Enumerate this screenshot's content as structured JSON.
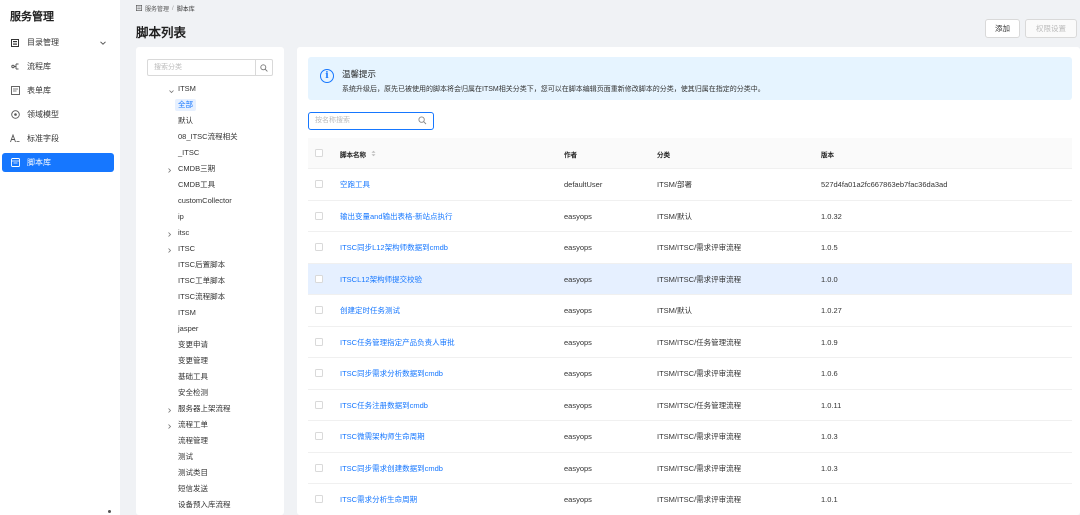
{
  "nav": {
    "title": "服务管理",
    "items": [
      {
        "label": "目录管理",
        "icon": "catalog-icon"
      },
      {
        "label": "流程库",
        "icon": "flow-icon"
      },
      {
        "label": "表单库",
        "icon": "form-icon"
      },
      {
        "label": "领域模型",
        "icon": "domain-model-icon"
      },
      {
        "label": "标准字段",
        "icon": "standard-field-icon"
      },
      {
        "label": "脚本库",
        "icon": "script-icon"
      }
    ],
    "active": "脚本库"
  },
  "header": {
    "breadcrumb": [
      "服务管理",
      "脚本库"
    ],
    "breadcrumb_sep": "/",
    "title": "脚本列表",
    "add_label": "添加",
    "perm_label": "权限设置"
  },
  "category": {
    "search_placeholder": "搜索分类",
    "root": "ITSM",
    "nodes": [
      {
        "label": "全部",
        "selected": true
      },
      {
        "label": "默认"
      },
      {
        "label": "08_ITSC流程相关"
      },
      {
        "label": "_ITSC"
      },
      {
        "label": "CMDB三期",
        "expandable": true
      },
      {
        "label": "CMDB工具"
      },
      {
        "label": "customCollector"
      },
      {
        "label": "ip"
      },
      {
        "label": "itsc",
        "expandable": true
      },
      {
        "label": "ITSC",
        "expandable": true
      },
      {
        "label": "ITSC后置脚本"
      },
      {
        "label": "ITSC工单脚本"
      },
      {
        "label": "ITSC流程脚本"
      },
      {
        "label": "ITSM"
      },
      {
        "label": "jasper"
      },
      {
        "label": "变更申请"
      },
      {
        "label": "变更管理"
      },
      {
        "label": "基础工具"
      },
      {
        "label": "安全检测"
      },
      {
        "label": "服务器上架流程",
        "expandable": true
      },
      {
        "label": "流程工单",
        "expandable": true
      },
      {
        "label": "流程管理"
      },
      {
        "label": "测试"
      },
      {
        "label": "测试类目"
      },
      {
        "label": "短信发送"
      },
      {
        "label": "设备预入库流程"
      }
    ]
  },
  "tip": {
    "title": "温馨提示",
    "text": "系统升级后，原先已被使用的脚本将会归属在ITSM相关分类下，您可以在脚本编辑页面重新修改脚本的分类，使其归属在指定的分类中。"
  },
  "name_search_placeholder": "按名称搜索",
  "table": {
    "headers": {
      "name": "脚本名称",
      "author": "作者",
      "category": "分类",
      "version": "版本"
    },
    "rows": [
      {
        "name": "空跑工具",
        "author": "defaultUser",
        "category": "ITSM/部署",
        "version": "527d4fa01a2fc667863eb7fac36da3ad"
      },
      {
        "name": "输出变量and输出表格-新站点执行",
        "author": "easyops",
        "category": "ITSM/默认",
        "version": "1.0.32"
      },
      {
        "name": "ITSC同步L12架构师数据到cmdb",
        "author": "easyops",
        "category": "ITSM/ITSC/需求评审流程",
        "version": "1.0.5"
      },
      {
        "name": "ITSCL12架构师提交校验",
        "author": "easyops",
        "category": "ITSM/ITSC/需求评审流程",
        "version": "1.0.0",
        "highlighted": true
      },
      {
        "name": "创建定时任务测试",
        "author": "easyops",
        "category": "ITSM/默认",
        "version": "1.0.27"
      },
      {
        "name": "ITSC任务管理指定产品负责人审批",
        "author": "easyops",
        "category": "ITSM/ITSC/任务管理流程",
        "version": "1.0.9"
      },
      {
        "name": "ITSC同步需求分析数据到cmdb",
        "author": "easyops",
        "category": "ITSM/ITSC/需求评审流程",
        "version": "1.0.6"
      },
      {
        "name": "ITSC任务注册数据到cmdb",
        "author": "easyops",
        "category": "ITSM/ITSC/任务管理流程",
        "version": "1.0.11"
      },
      {
        "name": "ITSC微需架构师生命周期",
        "author": "easyops",
        "category": "ITSM/ITSC/需求评审流程",
        "version": "1.0.3"
      },
      {
        "name": "ITSC同步需求创建数据到cmdb",
        "author": "easyops",
        "category": "ITSM/ITSC/需求评审流程",
        "version": "1.0.3"
      },
      {
        "name": "ITSC需求分析生命周期",
        "author": "easyops",
        "category": "ITSM/ITSC/需求评审流程",
        "version": "1.0.1"
      }
    ]
  },
  "colors": {
    "accent": "#1677ff",
    "highlight_row": "#e6f0ff",
    "tip_bg": "#e6f4ff"
  }
}
